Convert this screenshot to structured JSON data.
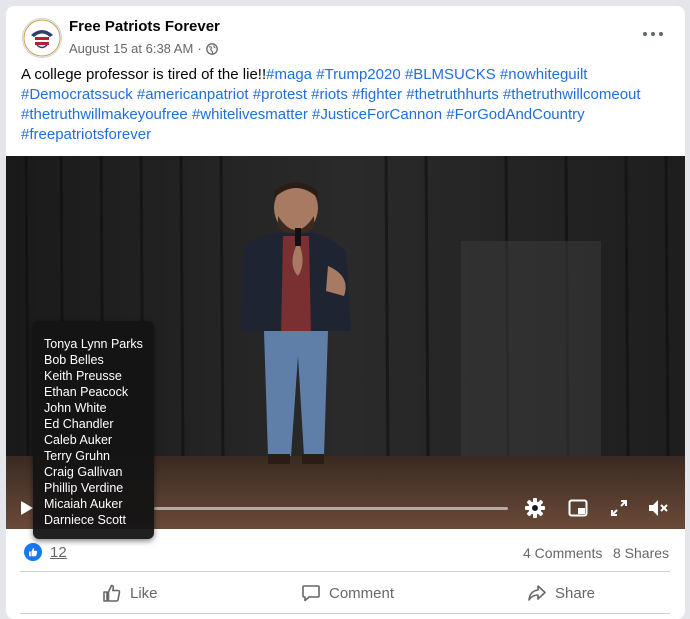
{
  "post": {
    "page_name": "Free Patriots Forever",
    "timestamp": "August 15 at 6:38 AM",
    "separator": "·",
    "privacy_icon": "globe-icon",
    "more_icon": "more-options-icon",
    "text_plain": "A college professor is tired of the lie!!",
    "hashtags": [
      "#maga",
      "#Trump2020",
      "#BLMSUCKS",
      "#nowhiteguilt",
      "#Democratssuck",
      "#americanpatriot",
      "#protest",
      "#riots",
      "#fighter",
      "#thetruthhurts",
      "#thetruthwillcomeout",
      "#thetruthwillmakeyoufree",
      "#whitelivesmatter",
      "#JusticeForCannon",
      "#ForGodAndCountry",
      "#freepatriotsforever"
    ]
  },
  "video": {
    "controls": [
      "play-icon",
      "settings-icon",
      "pip-icon",
      "fullscreen-icon",
      "mute-icon"
    ],
    "progress": 0
  },
  "reactions_panel": {
    "names": [
      "Tonya Lynn Parks",
      "Bob Belles",
      "Keith Preusse",
      "Ethan Peacock",
      "John White",
      "Ed Chandler",
      "Caleb Auker",
      "Terry Gruhn",
      "Craig Gallivan",
      "Phillip Verdine",
      "Micaiah Auker",
      "Darniece Scott"
    ]
  },
  "stats": {
    "reaction_icon": "like-reaction-icon",
    "reaction_count": "12",
    "comments": "4 Comments",
    "shares": "8 Shares"
  },
  "actions": {
    "like": "Like",
    "comment": "Comment",
    "share": "Share"
  },
  "colors": {
    "hashtag": "#216fdb",
    "like_blue": "#1877f2",
    "secondary_text": "#65676b"
  }
}
